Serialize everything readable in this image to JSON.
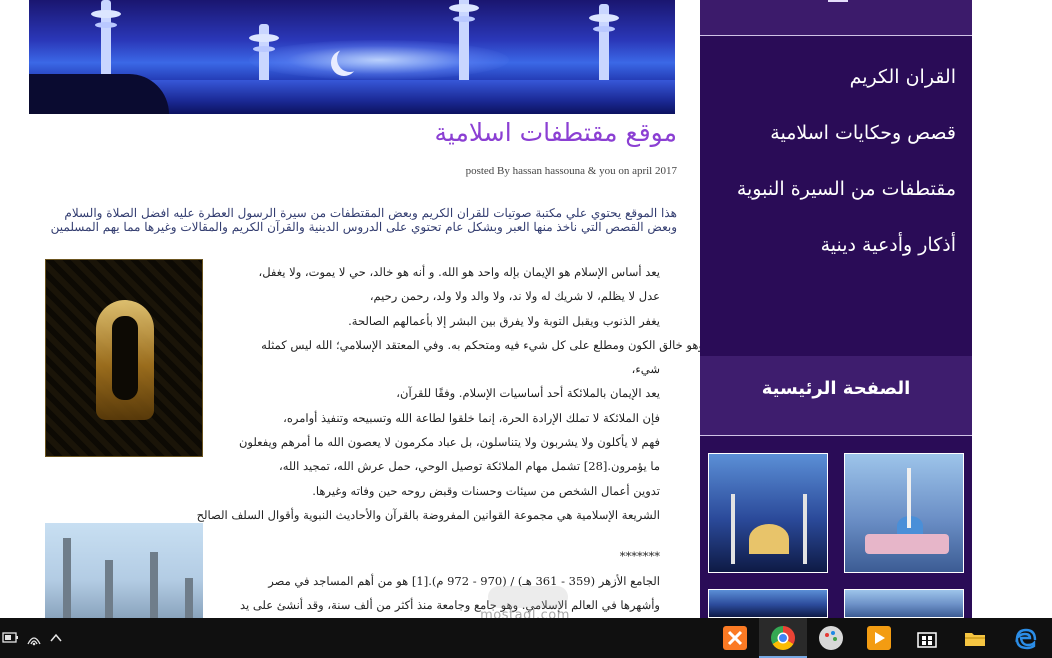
{
  "article": {
    "title": "موقع مقتطفات اسلامية",
    "meta": "posted By hassan hassouna & you on april 2017",
    "intro_lines": [
      "هذا الموقع يحتوي علي مكتبة صوتيات للقران الكريم وبعض المقتطفات من سيرة الرسول العطرة عليه افضل الصلاة والسلام",
      "وبعض القصص التي ناخذ منها العبر وبشكل عام تحتوي على الدروس الدينية والقرآن الكريم والمقالات وغيرها مما يهم المسلمين"
    ],
    "body_lines": [
      "يعد أساس الإسلام هو الإيمان بإله واحد هو الله. و أنه هو خالد، حي لا يموت، ولا يغفل،",
      "عدل لا يظلم، لا شريك له ولا ند، ولا والد ولا ولد، رحمن رحيم،",
      "يغفر الذنوب ويقبل التوبة ولا يفرق بين البشر إلا بأعمالهم الصالحة.",
      "وهو خالق الكون ومطلع على كل شيء فيه ومتحكم به. وفي المعتقد الإسلامي؛ الله ليس كمثله",
      "شيء،",
      "يعد الإيمان بالملائكة أحد أساسيات الإسلام. وفقًا للقرآن،",
      "فإن الملائكة لا تملك الإرادة الحرة، إنما خلقوا لطاعة الله وتسبيحه وتنفيذ أوامره،",
      "فهم لا يأكلون ولا يشربون ولا يتناسلون، بل عباد مكرمون لا يعصون الله ما أمرهم ويفعلون",
      "ما يؤمرون.[28] تشمل مهام الملائكة توصيل الوحي، حمل عرش الله، تمجيد الله،",
      "تدوين أعمال الشخص من سيئات وحسنات وقبض روحه حين وفاته وغيرها.",
      "الشريعة الإسلامية هي مجموعة القوانين المفروضة بالقرآن والأحاديث النبوية وأقوال السلف الصالح"
    ],
    "body_lines_2": [
      "*******",
      "الجامع الأزهر (359 - 361 هـ) / (970 - 972 م).[1] هو من أهم المساجد في مصر",
      "وأشهرها في العالم الإسلامي. وهو جامع وجامعة منذ أكثر من ألف سنة، وقد أنشئ على يد"
    ]
  },
  "sidebar": {
    "menu": [
      "القران الكريم",
      "قصص وحكايات اسلامية",
      "مقتطفات من السيرة النبوية",
      "أذكار وأدعية دينية"
    ],
    "home_label": "الصفحة الرئيسية"
  },
  "watermark": "mostaql.com",
  "colors": {
    "title": "#8b3fd3",
    "sidebar_bg": "#2a0c57",
    "taskbar_bg": "#101010"
  },
  "taskbar": {
    "apps": [
      "xampp-icon",
      "chrome-icon",
      "paint-icon",
      "media-icon",
      "store-icon",
      "file-explorer-icon",
      "edge-icon"
    ]
  }
}
